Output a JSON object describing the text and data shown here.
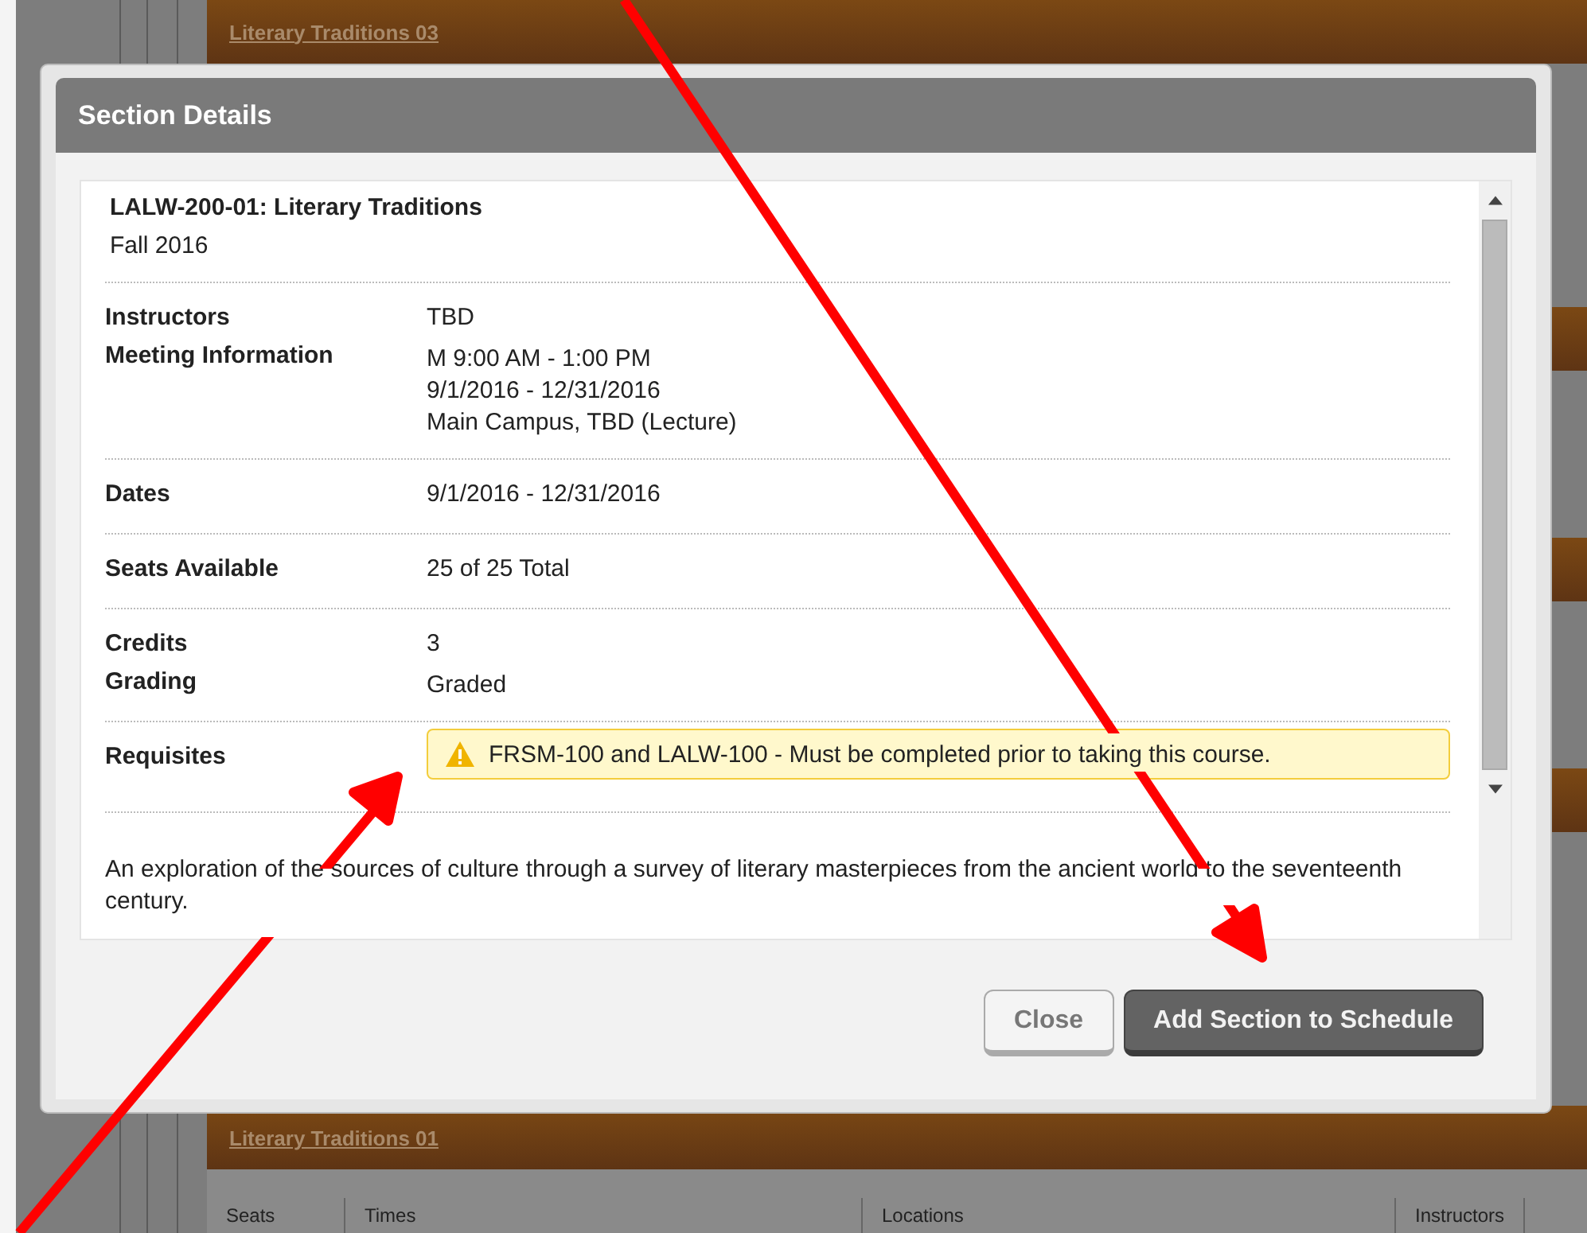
{
  "background": {
    "top_course": "Literary Traditions 03",
    "bottom_course": "Literary Traditions 01",
    "table_columns": [
      "Seats",
      "Times",
      "Locations",
      "Instructors"
    ]
  },
  "dialog": {
    "title": "Section Details",
    "course": {
      "heading": "LALW-200-01: Literary Traditions",
      "term": "Fall 2016"
    },
    "rows": [
      {
        "kind": "fields",
        "fields": [
          {
            "label": "Instructors",
            "lines": [
              "TBD"
            ]
          },
          {
            "label": "Meeting Information",
            "lines": [
              "M 9:00 AM - 1:00 PM",
              "9/1/2016 - 12/31/2016",
              "Main Campus, TBD (Lecture)"
            ]
          }
        ]
      },
      {
        "kind": "fields",
        "fields": [
          {
            "label": "Dates",
            "lines": [
              "9/1/2016 - 12/31/2016"
            ]
          }
        ]
      },
      {
        "kind": "fields",
        "fields": [
          {
            "label": "Seats Available",
            "lines": [
              "25 of 25 Total"
            ]
          }
        ]
      },
      {
        "kind": "fields",
        "fields": [
          {
            "label": "Credits",
            "lines": [
              "3"
            ]
          },
          {
            "label": "Grading",
            "lines": [
              "Graded"
            ]
          }
        ]
      },
      {
        "kind": "warning",
        "label": "Requisites",
        "message": "FRSM-100 and LALW-100 - Must be completed prior to taking this course."
      }
    ],
    "description": "An exploration of the sources of culture through a survey of literary masterpieces from the ancient world to the seventeenth century.",
    "buttons": [
      {
        "label": "Close",
        "kind": "secondary"
      },
      {
        "label": "Add Section to Schedule",
        "kind": "primary"
      }
    ]
  }
}
